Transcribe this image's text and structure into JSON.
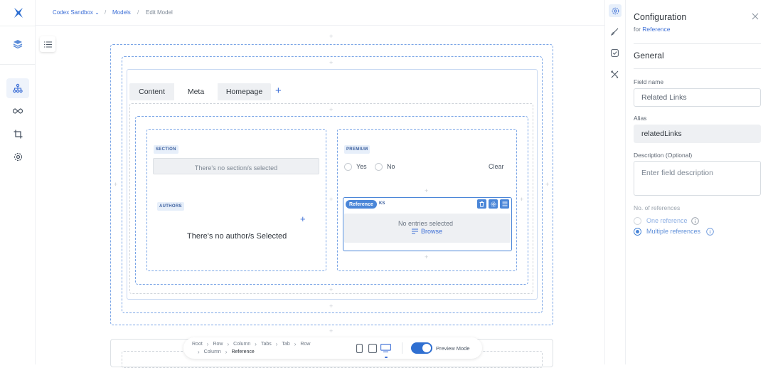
{
  "breadcrumb": {
    "workspace": "Codex Sandbox",
    "models": "Models",
    "current": "Edit Model",
    "sep": "/"
  },
  "tabs": [
    {
      "label": "Content"
    },
    {
      "label": "Meta"
    },
    {
      "label": "Homepage"
    }
  ],
  "tab_add": "+",
  "section": {
    "tag": "SECTION",
    "placeholder": "There's no section/s selected"
  },
  "authors": {
    "tag": "AUTHORS",
    "empty": "There's no author/s Selected",
    "add": "+"
  },
  "premium": {
    "tag": "PREMIUM",
    "yes": "Yes",
    "no": "No",
    "clear": "Clear"
  },
  "reference": {
    "badge": "Reference",
    "tag_tail": "KS",
    "empty": "No entries selected",
    "browse": "Browse"
  },
  "footer_breadcrumb": {
    "row1": [
      "Root",
      "Row",
      "Column",
      "Tabs",
      "Tab",
      "Row"
    ],
    "row2": [
      "Column",
      "Reference"
    ]
  },
  "preview": {
    "label": "Preview Mode",
    "enabled": true
  },
  "config": {
    "title": "Configuration",
    "for_prefix": "for",
    "for_link": "Reference",
    "section": "General",
    "field_name_label": "Field name",
    "field_name_value": "Related Links",
    "alias_label": "Alias",
    "alias_value": "relatedLinks",
    "description_label": "Description (Optional)",
    "description_placeholder": "Enter field description",
    "refs_label": "No. of references",
    "one_ref": "One reference",
    "multi_ref": "Multiple references",
    "selected": "multiple"
  },
  "colors": {
    "accent": "#3d6fd6",
    "toggle": "#2f6fd1"
  }
}
